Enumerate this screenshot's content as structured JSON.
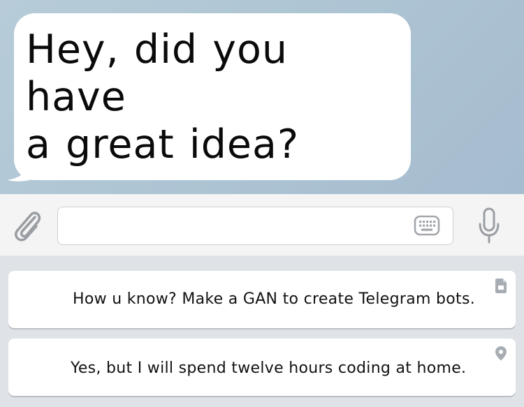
{
  "chat": {
    "message_line1": "Hey, did you have",
    "message_line2": "a great idea?"
  },
  "composer": {
    "input_value": "",
    "attach_icon": "paperclip-icon",
    "keyboard_icon": "keyboard-icon",
    "mic_icon": "microphone-icon"
  },
  "keyboard": {
    "buttons": [
      {
        "label": "How u know? Make a GAN to create Telegram bots.",
        "icon": "document-icon"
      },
      {
        "label": "Yes, but I will spend twelve hours coding at home.",
        "icon": "location-pin-icon"
      }
    ]
  },
  "colors": {
    "chat_background": "#aec5d4",
    "bubble": "#ffffff",
    "icon_gray": "#9a9ea3",
    "keyboard_background": "#dfe3e8"
  }
}
